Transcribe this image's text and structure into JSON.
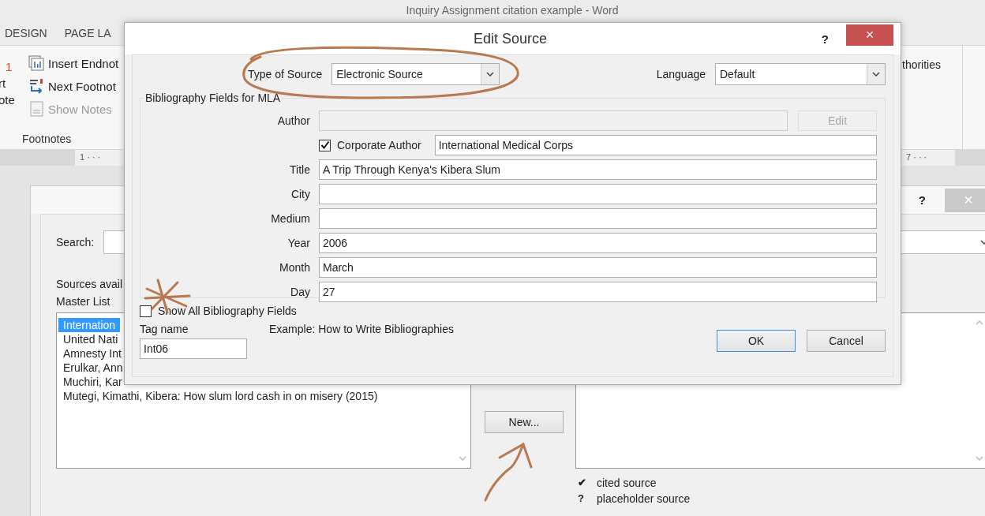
{
  "word": {
    "title": "Inquiry Assignment citation example - Word",
    "ribbon_tabs": [
      "DESIGN",
      "PAGE LA"
    ],
    "ribbon": {
      "cut_button": {
        "number": "1",
        "lines": [
          "rt",
          "ote"
        ]
      },
      "commands": [
        {
          "kind": "endnote",
          "label": "Insert Endnot",
          "disabled": false
        },
        {
          "kind": "next",
          "label": "Next Footnot",
          "disabled": false
        },
        {
          "kind": "show",
          "label": "Show Notes",
          "disabled": true
        }
      ],
      "group_label": "Footnotes",
      "right_fragment": "thorities"
    },
    "ruler": {
      "left": "1 · · ·",
      "right": "7 · · ·"
    }
  },
  "manage_sources": {
    "help": "?",
    "close": "×",
    "search_label": "Search:",
    "sources_label": "Sources avail",
    "list_label": "Master List",
    "sources": [
      {
        "text": "Internation",
        "selected": true
      },
      {
        "text": "United Nati",
        "selected": false
      },
      {
        "text": "Amnesty Int",
        "selected": false
      },
      {
        "text": "Erulkar, Ann",
        "selected": false
      },
      {
        "text": "Muchiri, Kar",
        "selected": false
      },
      {
        "text": "Mutegi, Kimathi, Kibera: How slum lord cash in on misery (2015)",
        "selected": false
      }
    ],
    "new_button": "New...",
    "legend": [
      {
        "icon": "✔",
        "text": "cited source"
      },
      {
        "icon": "?",
        "text": "placeholder source"
      }
    ]
  },
  "edit_source": {
    "title": "Edit Source",
    "help": "?",
    "close": "×",
    "type_label": "Type of Source",
    "type_value": "Electronic Source",
    "language_label": "Language",
    "language_value": "Default",
    "group_title": "Bibliography Fields for MLA",
    "fields": [
      {
        "kind": "author",
        "label": "Author",
        "disabled": true,
        "edit_button": {
          "label": "Edit",
          "disabled": true
        }
      },
      {
        "kind": "corporate",
        "label": "Corporate Author",
        "checked": true,
        "value": "International Medical Corps"
      },
      {
        "kind": "text",
        "label": "Title",
        "value": "A Trip Through Kenya's Kibera Slum"
      },
      {
        "kind": "text",
        "label": "City"
      },
      {
        "kind": "text",
        "label": "Medium"
      },
      {
        "kind": "text",
        "label": "Year",
        "value": "2006"
      },
      {
        "kind": "text",
        "label": "Month",
        "value": "March"
      },
      {
        "kind": "text",
        "label": "Day",
        "value": "27"
      }
    ],
    "show_all": {
      "label": "Show All Bibliography Fields",
      "checked": false
    },
    "tag_label": "Tag name",
    "tag_value": "Int06",
    "example": "Example: How to Write Bibliographies",
    "buttons": [
      {
        "label": "OK",
        "default": true
      },
      {
        "label": "Cancel",
        "default": false
      }
    ]
  }
}
